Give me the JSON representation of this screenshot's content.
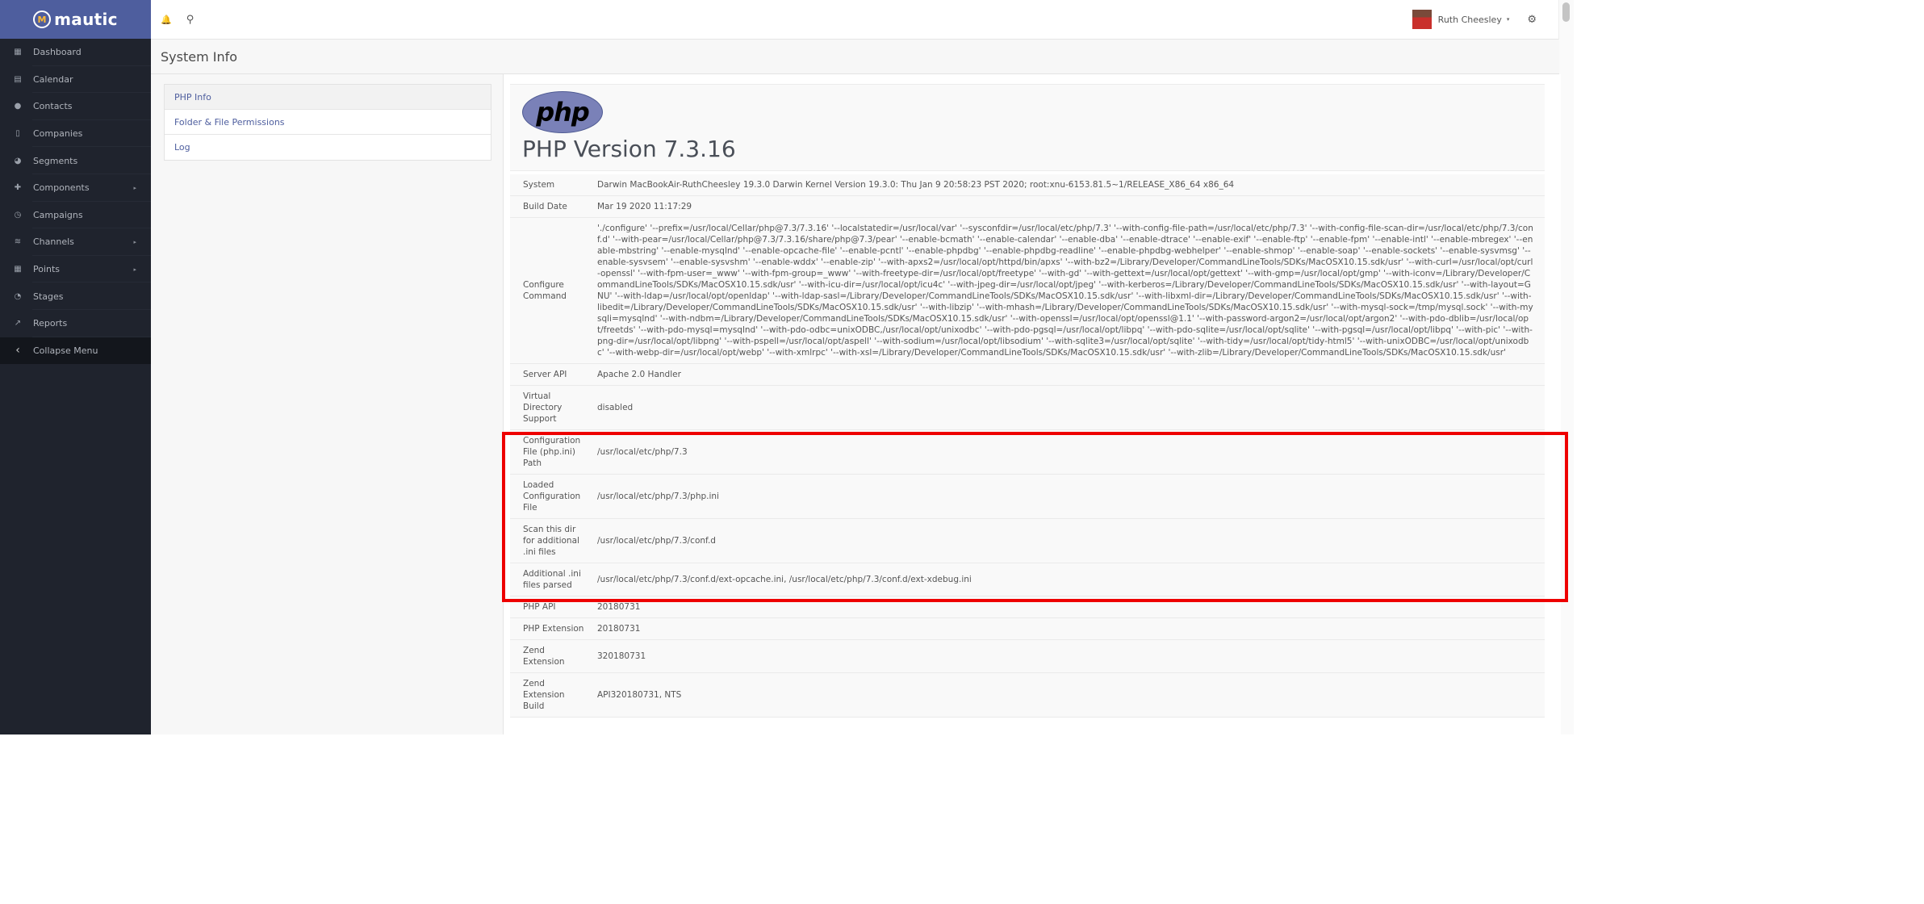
{
  "brand": {
    "name": "mautic",
    "logo_letter": "M"
  },
  "sidebar": {
    "items": [
      {
        "label": "Dashboard",
        "icon": "dashboard-icon",
        "glyph": "▦",
        "arrow": false
      },
      {
        "label": "Calendar",
        "icon": "calendar-icon",
        "glyph": "▤",
        "arrow": false
      },
      {
        "label": "Contacts",
        "icon": "user-icon",
        "glyph": "●",
        "arrow": false
      },
      {
        "label": "Companies",
        "icon": "building-icon",
        "glyph": "▯",
        "arrow": false
      },
      {
        "label": "Segments",
        "icon": "pie-chart-icon",
        "glyph": "◕",
        "arrow": false
      },
      {
        "label": "Components",
        "icon": "puzzle-icon",
        "glyph": "✚",
        "arrow": true
      },
      {
        "label": "Campaigns",
        "icon": "clock-icon",
        "glyph": "◷",
        "arrow": false
      },
      {
        "label": "Channels",
        "icon": "rss-icon",
        "glyph": "≋",
        "arrow": true
      },
      {
        "label": "Points",
        "icon": "calculator-icon",
        "glyph": "▦",
        "arrow": true
      },
      {
        "label": "Stages",
        "icon": "tachometer-icon",
        "glyph": "◔",
        "arrow": false
      },
      {
        "label": "Reports",
        "icon": "line-chart-icon",
        "glyph": "↗",
        "arrow": false
      }
    ],
    "collapse": {
      "label": "Collapse Menu",
      "glyph": "‹"
    },
    "arrow_glyph": "▸"
  },
  "header": {
    "bell_glyph": "🔔",
    "search_glyph": "⚲",
    "user_name": "Ruth Cheesley",
    "caret_glyph": "▾",
    "gear_glyph": "⚙"
  },
  "page": {
    "title": "System Info"
  },
  "tabs": [
    {
      "label": "PHP Info",
      "active": true
    },
    {
      "label": "Folder & File Permissions",
      "active": false
    },
    {
      "label": "Log",
      "active": false
    }
  ],
  "phpinfo": {
    "logo_text": "php",
    "version_title": "PHP Version 7.3.16",
    "rows": [
      {
        "key": "System",
        "value": "Darwin MacBookAir-RuthCheesley 19.3.0 Darwin Kernel Version 19.3.0: Thu Jan 9 20:58:23 PST 2020; root:xnu-6153.81.5~1/RELEASE_X86_64 x86_64"
      },
      {
        "key": "Build Date",
        "value": "Mar 19 2020 11:17:29"
      },
      {
        "key": "Configure Command",
        "value": "'./configure' '--prefix=/usr/local/Cellar/php@7.3/7.3.16' '--localstatedir=/usr/local/var' '--sysconfdir=/usr/local/etc/php/7.3' '--with-config-file-path=/usr/local/etc/php/7.3' '--with-config-file-scan-dir=/usr/local/etc/php/7.3/conf.d' '--with-pear=/usr/local/Cellar/php@7.3/7.3.16/share/php@7.3/pear' '--enable-bcmath' '--enable-calendar' '--enable-dba' '--enable-dtrace' '--enable-exif' '--enable-ftp' '--enable-fpm' '--enable-intl' '--enable-mbregex' '--enable-mbstring' '--enable-mysqlnd' '--enable-opcache-file' '--enable-pcntl' '--enable-phpdbg' '--enable-phpdbg-readline' '--enable-phpdbg-webhelper' '--enable-shmop' '--enable-soap' '--enable-sockets' '--enable-sysvmsg' '--enable-sysvsem' '--enable-sysvshm' '--enable-wddx' '--enable-zip' '--with-apxs2=/usr/local/opt/httpd/bin/apxs' '--with-bz2=/Library/Developer/CommandLineTools/SDKs/MacOSX10.15.sdk/usr' '--with-curl=/usr/local/opt/curl-openssl' '--with-fpm-user=_www' '--with-fpm-group=_www' '--with-freetype-dir=/usr/local/opt/freetype' '--with-gd' '--with-gettext=/usr/local/opt/gettext' '--with-gmp=/usr/local/opt/gmp' '--with-iconv=/Library/Developer/CommandLineTools/SDKs/MacOSX10.15.sdk/usr' '--with-icu-dir=/usr/local/opt/icu4c' '--with-jpeg-dir=/usr/local/opt/jpeg' '--with-kerberos=/Library/Developer/CommandLineTools/SDKs/MacOSX10.15.sdk/usr' '--with-layout=GNU' '--with-ldap=/usr/local/opt/openldap' '--with-ldap-sasl=/Library/Developer/CommandLineTools/SDKs/MacOSX10.15.sdk/usr' '--with-libxml-dir=/Library/Developer/CommandLineTools/SDKs/MacOSX10.15.sdk/usr' '--with-libedit=/Library/Developer/CommandLineTools/SDKs/MacOSX10.15.sdk/usr' '--with-libzip' '--with-mhash=/Library/Developer/CommandLineTools/SDKs/MacOSX10.15.sdk/usr' '--with-mysql-sock=/tmp/mysql.sock' '--with-mysqli=mysqlnd' '--with-ndbm=/Library/Developer/CommandLineTools/SDKs/MacOSX10.15.sdk/usr' '--with-openssl=/usr/local/opt/openssl@1.1' '--with-password-argon2=/usr/local/opt/argon2' '--with-pdo-dblib=/usr/local/opt/freetds' '--with-pdo-mysql=mysqlnd' '--with-pdo-odbc=unixODBC,/usr/local/opt/unixodbc' '--with-pdo-pgsql=/usr/local/opt/libpq' '--with-pdo-sqlite=/usr/local/opt/sqlite' '--with-pgsql=/usr/local/opt/libpq' '--with-pic' '--with-png-dir=/usr/local/opt/libpng' '--with-pspell=/usr/local/opt/aspell' '--with-sodium=/usr/local/opt/libsodium' '--with-sqlite3=/usr/local/opt/sqlite' '--with-tidy=/usr/local/opt/tidy-html5' '--with-unixODBC=/usr/local/opt/unixodbc' '--with-webp-dir=/usr/local/opt/webp' '--with-xmlrpc' '--with-xsl=/Library/Developer/CommandLineTools/SDKs/MacOSX10.15.sdk/usr' '--with-zlib=/Library/Developer/CommandLineTools/SDKs/MacOSX10.15.sdk/usr'"
      },
      {
        "key": "Server API",
        "value": "Apache 2.0 Handler"
      },
      {
        "key": "Virtual Directory Support",
        "value": "disabled"
      },
      {
        "key": "Configuration File (php.ini) Path",
        "value": "/usr/local/etc/php/7.3"
      },
      {
        "key": "Loaded Configuration File",
        "value": "/usr/local/etc/php/7.3/php.ini"
      },
      {
        "key": "Scan this dir for additional .ini files",
        "value": "/usr/local/etc/php/7.3/conf.d"
      },
      {
        "key": "Additional .ini files parsed",
        "value": "/usr/local/etc/php/7.3/conf.d/ext-opcache.ini, /usr/local/etc/php/7.3/conf.d/ext-xdebug.ini"
      },
      {
        "key": "PHP API",
        "value": "20180731"
      },
      {
        "key": "PHP Extension",
        "value": "20180731"
      },
      {
        "key": "Zend Extension",
        "value": "320180731"
      },
      {
        "key": "Zend Extension Build",
        "value": "API320180731, NTS"
      }
    ]
  },
  "annotation": {
    "color": "#ee0000",
    "label": "highlight-box"
  }
}
